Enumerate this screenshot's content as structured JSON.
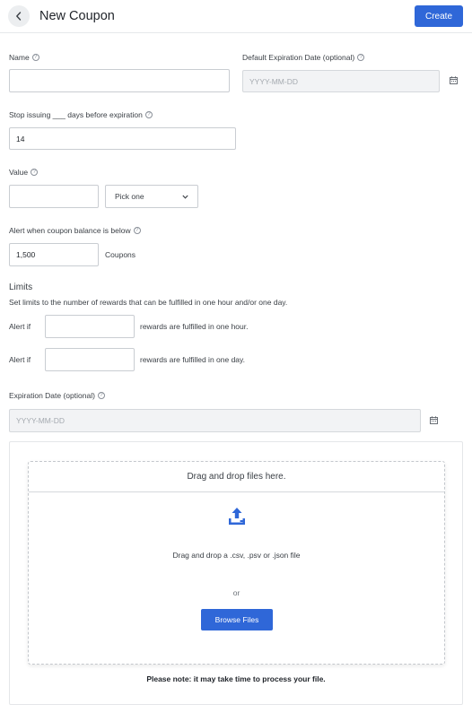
{
  "header": {
    "title": "New Coupon",
    "create_label": "Create"
  },
  "form": {
    "name": {
      "label": "Name",
      "value": ""
    },
    "default_expiration": {
      "label": "Default Expiration Date (optional)",
      "placeholder": "YYYY-MM-DD"
    },
    "stop_issuing": {
      "label": "Stop issuing ___ days before expiration",
      "value": "14"
    },
    "value": {
      "label": "Value",
      "amount": "",
      "unit_selected": "Pick one"
    },
    "alert_balance": {
      "label": "Alert when coupon balance is below",
      "value": "1,500",
      "suffix": "Coupons"
    },
    "limits": {
      "title": "Limits",
      "description": "Set limits to the number of rewards that can be fulfilled in one hour and/or one day.",
      "hour": {
        "prefix": "Alert if",
        "suffix": "rewards are fulfilled in one hour.",
        "value": ""
      },
      "day": {
        "prefix": "Alert if",
        "suffix": "rewards are fulfilled in one day.",
        "value": ""
      }
    },
    "expiration": {
      "label": "Expiration Date (optional)",
      "placeholder": "YYYY-MM-DD"
    }
  },
  "upload": {
    "dropzone_title": "Drag and drop files here.",
    "instructions": "Drag and drop a .csv, .psv or .json file",
    "or_text": "or",
    "browse_label": "Browse Files",
    "note": "Please note: it may take time to process your file."
  },
  "colors": {
    "primary": "#2f67d8",
    "border": "#c9cdd2",
    "disabled_bg": "#f2f3f5"
  }
}
